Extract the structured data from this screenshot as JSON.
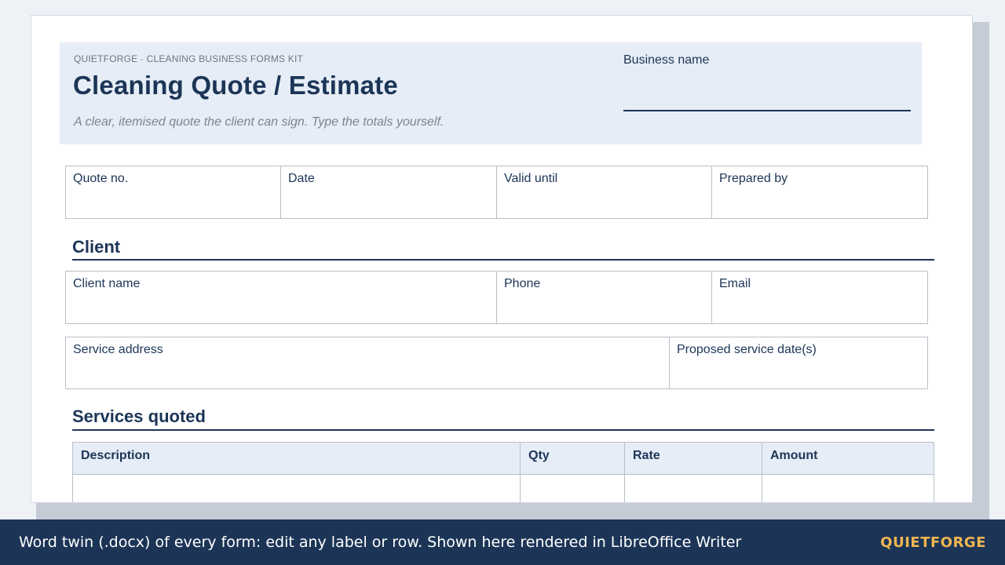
{
  "header": {
    "kicker": "QUIETFORGE · CLEANING BUSINESS FORMS KIT",
    "title": "Cleaning Quote / Estimate",
    "subtitle": "A clear, itemised quote the client can sign. Type the totals yourself.",
    "business_name_label": "Business name"
  },
  "quote_fields": [
    "Quote no.",
    "Date",
    "Valid until",
    "Prepared by"
  ],
  "client": {
    "heading": "Client",
    "row1": [
      "Client name",
      "Phone",
      "Email"
    ],
    "row2": [
      "Service address",
      "Proposed service date(s)"
    ]
  },
  "services": {
    "heading": "Services quoted",
    "columns": [
      "Description",
      "Qty",
      "Rate",
      "Amount"
    ]
  },
  "footer": {
    "text": "Word twin (.docx) of every form: edit any label or row. Shown here rendered in LibreOffice Writer",
    "brand": "QUIETFORGE"
  }
}
